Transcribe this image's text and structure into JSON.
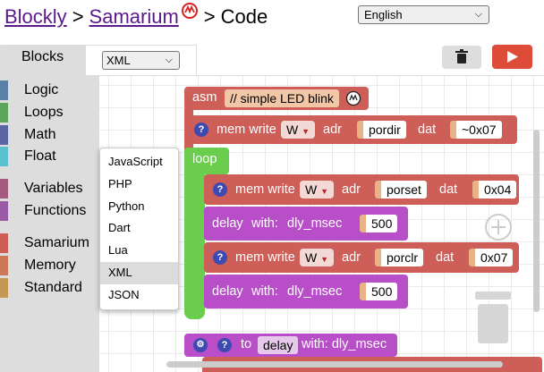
{
  "header": {
    "link1": "Blockly",
    "sep": ">",
    "link2": "Samarium",
    "tail": "Code",
    "language": "English"
  },
  "tabs": {
    "blocks": "Blocks",
    "code_select": "XML"
  },
  "toolbox": {
    "categories": [
      {
        "label": "Logic",
        "color": "#5b80a5"
      },
      {
        "label": "Loops",
        "color": "#5ba55b"
      },
      {
        "label": "Math",
        "color": "#5b67a5"
      },
      {
        "label": "Float",
        "color": "#5bc0cd"
      },
      {
        "label": "Variables",
        "color": "#a55b80"
      },
      {
        "label": "Functions",
        "color": "#995ba5"
      },
      {
        "label": "Samarium",
        "color": "#cd5e58"
      },
      {
        "label": "Memory",
        "color": "#cd7658"
      },
      {
        "label": "Standard",
        "color": "#c59855"
      }
    ]
  },
  "dropdown": {
    "options": [
      "JavaScript",
      "PHP",
      "Python",
      "Dart",
      "Lua",
      "XML",
      "JSON"
    ],
    "selected": "XML"
  },
  "blocks": {
    "asm_label": "asm",
    "asm_comment": "// simple LED blink",
    "qm": "?",
    "mem_write": "mem write",
    "w": "W",
    "adr": "adr",
    "dat": "dat",
    "loop": "loop",
    "delay": "delay",
    "with": "with:",
    "dly_msec": "dly_msec",
    "b1_adr": "pordir",
    "b1_dat": "~0x07",
    "b2_adr": "porset",
    "b2_dat": "0x04",
    "d1_val": "500",
    "b3_adr": "porclr",
    "b3_dat": "0x07",
    "d2_val": "500",
    "fn_to": "to",
    "fn_name": "delay",
    "fn_with": "with: dly_msec"
  }
}
